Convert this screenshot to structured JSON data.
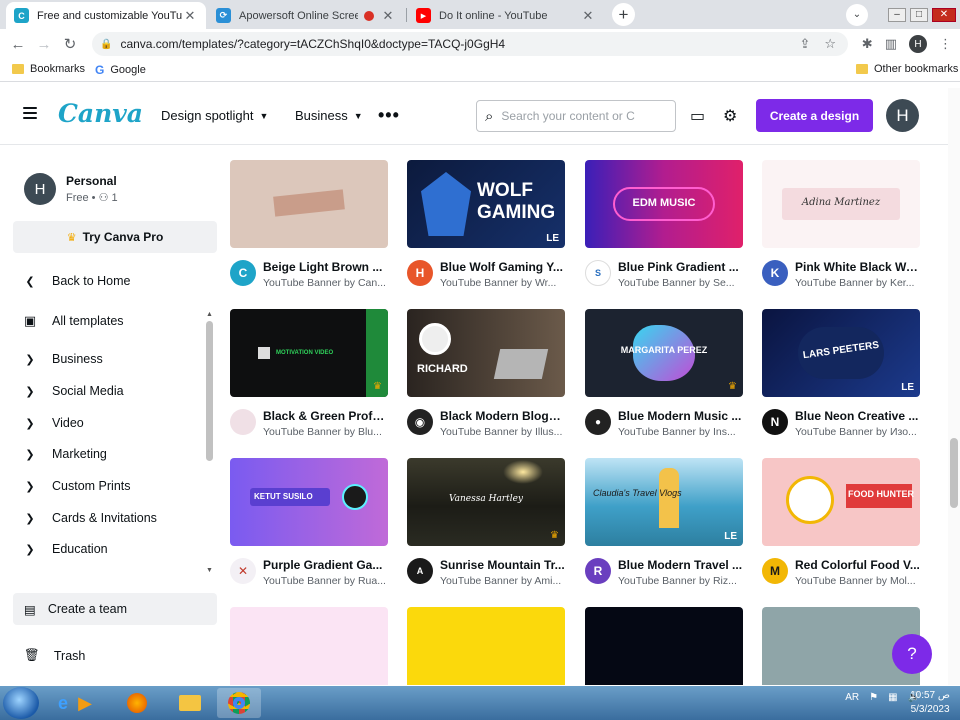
{
  "browser": {
    "tabs": [
      {
        "title": "Free and customizable YouTube",
        "active": true
      },
      {
        "title": "Apowersoft Online Screen Re",
        "active": false
      },
      {
        "title": "Do It online - YouTube",
        "active": false
      }
    ],
    "url": "canva.com/templates/?category=tACZChShqI0&doctype=TACQ-j0GgH4",
    "profile_initial": "H",
    "bookmarks": [
      "Bookmarks",
      "Google"
    ],
    "other_bookmarks": "Other bookmarks"
  },
  "header": {
    "logo": "Canva",
    "nav": [
      "Design spotlight",
      "Business"
    ],
    "search_placeholder": "Search your content or C",
    "create_label": "Create a design",
    "avatar_initial": "H"
  },
  "sidebar": {
    "account_initial": "H",
    "account_name": "Personal",
    "account_sub": "Free • ⚇ 1",
    "try_pro": "Try Canva Pro",
    "back_home": "Back to Home",
    "all_templates": "All templates",
    "categories": [
      "Business",
      "Social Media",
      "Video",
      "Marketing",
      "Custom Prints",
      "Cards & Invitations",
      "Education"
    ],
    "create_team": "Create a team",
    "trash": "Trash"
  },
  "templates": [
    {
      "title": "Beige Light Brown ...",
      "subtitle": "YouTube Banner by Can...",
      "creator_initial": "C",
      "creator_color": "#1ea4c8",
      "badge": "",
      "thumb_text": ""
    },
    {
      "title": "Blue Wolf Gaming Y...",
      "subtitle": "YouTube Banner by Wr...",
      "creator_initial": "H",
      "creator_color": "#e8562a",
      "badge": "LE",
      "thumb_text": "WOLF GAMING"
    },
    {
      "title": "Blue Pink Gradient ...",
      "subtitle": "YouTube Banner by Se...",
      "creator_initial": "S",
      "creator_color": "#ffffff",
      "badge": "",
      "thumb_text": "EDM MUSIC"
    },
    {
      "title": "Pink White Black Wa...",
      "subtitle": "YouTube Banner by Ker...",
      "creator_initial": "K",
      "creator_color": "#3a5fbf",
      "badge": "",
      "thumb_text": "Adina Martinez"
    },
    {
      "title": "Black & Green Profe...",
      "subtitle": "YouTube Banner by Blu...",
      "creator_initial": "",
      "creator_color": "#f0e0e6",
      "badge": "crown",
      "thumb_text": "MOTIVATION VIDEO"
    },
    {
      "title": "Black Modern Blogg...",
      "subtitle": "YouTube Banner by Illus...",
      "creator_initial": "◉",
      "creator_color": "#222222",
      "badge": "",
      "thumb_text": "RICHARD"
    },
    {
      "title": "Blue Modern Music ...",
      "subtitle": "YouTube Banner by Ins...",
      "creator_initial": "●",
      "creator_color": "#222222",
      "badge": "crown",
      "thumb_text": "MARGARITA PEREZ"
    },
    {
      "title": "Blue Neon Creative ...",
      "subtitle": "YouTube Banner by Изо...",
      "creator_initial": "N",
      "creator_color": "#111111",
      "badge": "LE",
      "thumb_text": "LARS PEETERS"
    },
    {
      "title": "Purple Gradient Ga...",
      "subtitle": "YouTube Banner by Rua...",
      "creator_initial": "✕",
      "creator_color": "#f3f0f5",
      "badge": "",
      "thumb_text": "KETUT SUSILO"
    },
    {
      "title": "Sunrise Mountain Tr...",
      "subtitle": "YouTube Banner by Ami...",
      "creator_initial": "A",
      "creator_color": "#1a1a1a",
      "badge": "crown",
      "thumb_text": "Vanessa Hartley"
    },
    {
      "title": "Blue Modern Travel ...",
      "subtitle": "YouTube Banner by Riz...",
      "creator_initial": "R",
      "creator_color": "#6a3fbf",
      "badge": "LE",
      "thumb_text": "Claudia's Travel Vlogs"
    },
    {
      "title": "Red Colorful Food V...",
      "subtitle": "YouTube Banner by Mol...",
      "creator_initial": "M",
      "creator_color": "#f2b705",
      "badge": "",
      "thumb_text": "FOOD HUNTER"
    }
  ],
  "help_label": "?",
  "taskbar": {
    "language": "AR",
    "time": "10:57 ص",
    "date": "5/3/2023"
  }
}
